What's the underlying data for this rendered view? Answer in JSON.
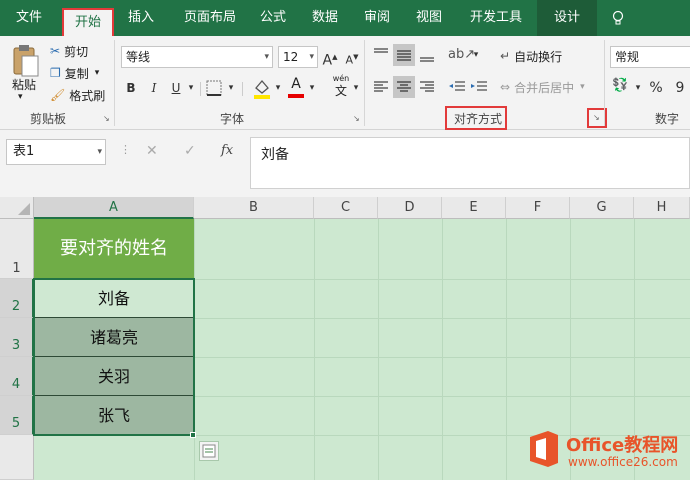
{
  "tabs": [
    "文件",
    "开始",
    "插入",
    "页面布局",
    "公式",
    "数据",
    "审阅",
    "视图",
    "开发工具",
    "设计"
  ],
  "lightbulb_icon": "lightbulb-icon",
  "clipboard": {
    "paste_label": "粘贴",
    "cut_label": "剪切",
    "copy_label": "复制",
    "format_painter_label": "格式刷",
    "group_label": "剪贴板"
  },
  "font": {
    "font_name": "等线",
    "font_size": "12",
    "grow_label": "A",
    "shrink_label": "A",
    "bold": "B",
    "italic": "I",
    "underline": "U",
    "font_color_label": "A",
    "phonetic_label": "wén",
    "group_label": "字体"
  },
  "alignment": {
    "wrap_text_label": "自动换行",
    "merge_center_label": "合并后居中",
    "group_label": "对齐方式"
  },
  "number": {
    "format_value": "常规",
    "percent_label": "%",
    "comma_label": "9",
    "group_label": "数字"
  },
  "formula_bar": {
    "name_box": "表1",
    "cancel": "✕",
    "enter": "✓",
    "fx": "fx",
    "content": "刘备"
  },
  "columns": [
    "A",
    "B",
    "C",
    "D",
    "E",
    "F",
    "G",
    "H"
  ],
  "rows": [
    "1",
    "2",
    "3",
    "4",
    "5"
  ],
  "cells": {
    "header": "要对齐的姓名",
    "names": [
      "刘备",
      "诸葛亮",
      "关羽",
      "张飞"
    ]
  },
  "colors": {
    "ribbon_green": "#217346",
    "header_fill": "#70ad47",
    "name_fill": "#9db7a1",
    "highlight_red": "#e23a3a",
    "sheet_tint": "#cde8d0"
  },
  "watermark": {
    "brand": "Office教程网",
    "url": "www.office26.com"
  }
}
